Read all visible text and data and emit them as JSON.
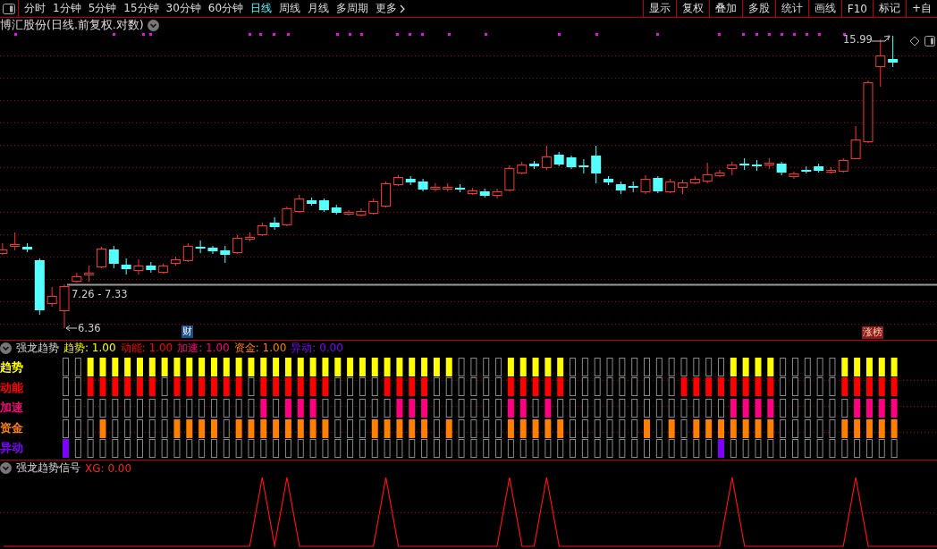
{
  "toolbar": {
    "tabs": [
      {
        "label": "分时",
        "selected": false
      },
      {
        "label": "1分钟",
        "selected": false
      },
      {
        "label": "5分钟",
        "selected": false
      },
      {
        "label": "15分钟",
        "selected": false
      },
      {
        "label": "30分钟",
        "selected": false
      },
      {
        "label": "60分钟",
        "selected": false
      },
      {
        "label": "日线",
        "selected": true
      },
      {
        "label": "周线",
        "selected": false
      },
      {
        "label": "月线",
        "selected": false
      },
      {
        "label": "多周期",
        "selected": false
      }
    ],
    "more": "更多",
    "buttons": [
      "显示",
      "复权",
      "叠加",
      "多股",
      "统计",
      "画线",
      "F10",
      "标记",
      "+自"
    ]
  },
  "chart": {
    "title": "博汇股份(日线.前复权.对数)",
    "high_label": "15.99",
    "range_label": "7.26 - 7.33",
    "low_label": "6.36",
    "badges": [
      {
        "text": "财",
        "kind": "finance"
      },
      {
        "text": "涨榜",
        "kind": "gainers"
      }
    ]
  },
  "indicator": {
    "title": "强龙趋势",
    "legend": [
      {
        "text": "趋势: 1.00",
        "color": "#ffff00"
      },
      {
        "text": "动能: 1.00",
        "color": "#ff0000"
      },
      {
        "text": "加速: 1.00",
        "color": "#ff0080"
      },
      {
        "text": "资金: 1.00",
        "color": "#ff8000"
      },
      {
        "text": "异动: 0.00",
        "color": "#8000ff"
      }
    ],
    "rows": [
      {
        "label": "趋势",
        "color": "#ffff00",
        "cells": [
          false,
          false,
          true,
          true,
          true,
          true,
          true,
          true,
          true,
          true,
          true,
          true,
          true,
          true,
          true,
          true,
          true,
          true,
          true,
          true,
          true,
          true,
          true,
          true,
          true,
          true,
          true,
          true,
          true,
          true,
          true,
          true,
          false,
          false,
          false,
          false,
          true,
          true,
          true,
          true,
          true,
          false,
          false,
          false,
          false,
          false,
          false,
          false,
          false,
          false,
          false,
          false,
          false,
          false,
          true,
          true,
          true,
          true,
          false,
          false,
          false,
          false,
          false,
          true,
          true,
          true,
          true,
          true
        ]
      },
      {
        "label": "动能",
        "color": "#ff0000",
        "cells": [
          false,
          false,
          true,
          true,
          true,
          true,
          true,
          true,
          false,
          true,
          true,
          true,
          true,
          true,
          true,
          false,
          true,
          true,
          true,
          true,
          true,
          true,
          false,
          false,
          false,
          false,
          true,
          true,
          true,
          true,
          false,
          false,
          false,
          false,
          false,
          false,
          true,
          true,
          true,
          true,
          true,
          false,
          false,
          false,
          false,
          false,
          false,
          false,
          false,
          false,
          true,
          true,
          true,
          true,
          true,
          true,
          true,
          true,
          false,
          false,
          false,
          false,
          false,
          true,
          true,
          true,
          true,
          true
        ]
      },
      {
        "label": "加速",
        "color": "#ff0080",
        "cells": [
          false,
          false,
          false,
          false,
          false,
          false,
          false,
          false,
          false,
          false,
          false,
          false,
          false,
          false,
          false,
          false,
          true,
          false,
          true,
          true,
          true,
          false,
          false,
          false,
          false,
          false,
          false,
          true,
          true,
          true,
          false,
          false,
          false,
          false,
          false,
          false,
          true,
          true,
          false,
          true,
          false,
          false,
          false,
          false,
          false,
          false,
          false,
          false,
          false,
          false,
          false,
          false,
          false,
          false,
          true,
          true,
          true,
          true,
          false,
          false,
          false,
          false,
          false,
          false,
          true,
          true,
          true,
          true
        ]
      },
      {
        "label": "资金",
        "color": "#ff8000",
        "cells": [
          false,
          false,
          false,
          true,
          false,
          false,
          false,
          false,
          false,
          true,
          true,
          true,
          true,
          false,
          true,
          true,
          true,
          true,
          true,
          true,
          true,
          true,
          false,
          false,
          false,
          true,
          true,
          true,
          true,
          true,
          false,
          true,
          false,
          false,
          false,
          false,
          true,
          true,
          true,
          true,
          true,
          false,
          false,
          false,
          false,
          false,
          false,
          true,
          false,
          true,
          false,
          true,
          true,
          true,
          true,
          true,
          true,
          true,
          false,
          false,
          false,
          false,
          false,
          true,
          true,
          true,
          true,
          true
        ]
      },
      {
        "label": "异动",
        "color": "#8000ff",
        "cells": [
          true,
          false,
          false,
          false,
          false,
          false,
          false,
          false,
          false,
          false,
          false,
          false,
          false,
          false,
          false,
          false,
          false,
          false,
          false,
          false,
          false,
          false,
          false,
          false,
          false,
          false,
          false,
          false,
          false,
          false,
          false,
          false,
          false,
          false,
          false,
          false,
          false,
          false,
          false,
          false,
          false,
          false,
          false,
          false,
          false,
          false,
          false,
          false,
          false,
          false,
          false,
          false,
          false,
          true,
          false,
          false,
          false,
          false,
          false,
          false,
          false,
          false,
          false,
          false,
          false,
          false,
          false,
          false
        ]
      }
    ]
  },
  "signal": {
    "title": "强龙趋势信号",
    "legend": "XG: 0.00"
  }
}
